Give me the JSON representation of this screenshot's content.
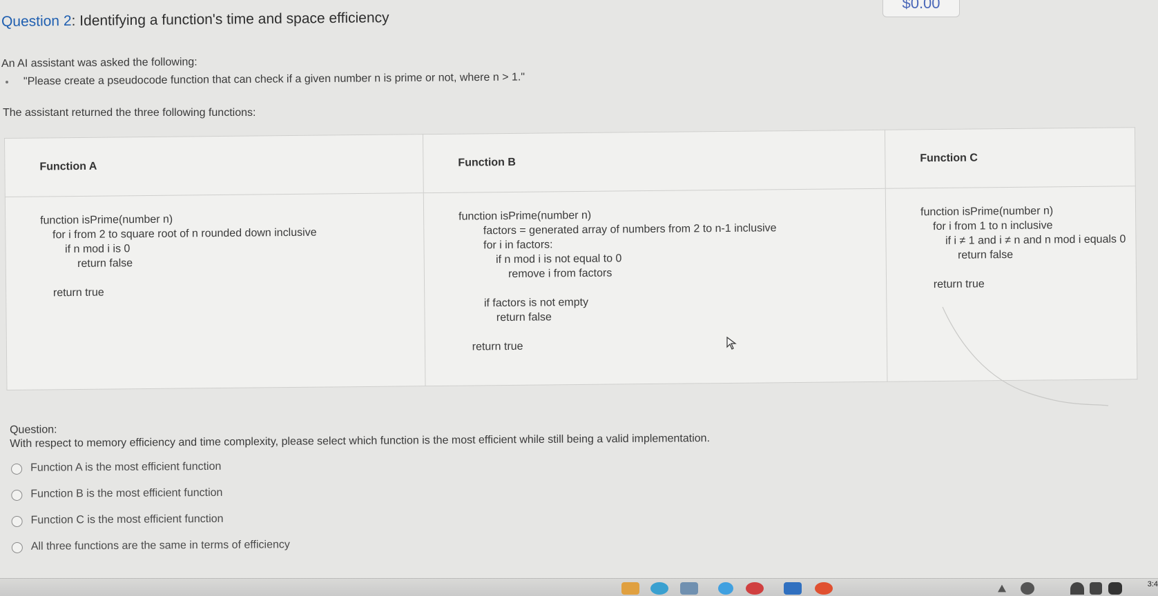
{
  "header": {
    "price": "$0.00",
    "question_number": "Question 2",
    "title_rest": ": Identifying a function's time and space efficiency"
  },
  "prompt": {
    "intro": "An AI assistant was asked the following:",
    "bullet": "\"Please create a pseudocode function that can check if a given number n is prime or not, where n > 1.\"",
    "returned": "The assistant returned the three following functions:"
  },
  "functions": [
    {
      "name": "Function A",
      "code": [
        "function isPrime(number n)",
        "    for i from 2 to square root of n rounded down inclusive",
        "        if n mod i is 0",
        "            return false",
        "",
        "    return true"
      ]
    },
    {
      "name": "Function B",
      "code": [
        "function isPrime(number n)",
        "        factors = generated array of numbers from 2 to n-1 inclusive",
        "        for i in factors:",
        "            if n mod i is not equal to 0",
        "                remove i from factors",
        "",
        "        if factors is not empty",
        "            return false",
        "",
        "    return true"
      ]
    },
    {
      "name": "Function C",
      "code": [
        "function isPrime(number n)",
        "    for i from 1 to n inclusive",
        "        if i ≠ 1 and i ≠ n and n mod i equals 0",
        "            return false",
        "",
        "    return true"
      ]
    }
  ],
  "question": {
    "label": "Question:",
    "text": "With respect to memory efficiency and time complexity, please select which function is the most efficient while still being a valid implementation.",
    "options": [
      "Function A is the most efficient function",
      "Function B is the most efficient function",
      "Function C is the most efficient function",
      "All three functions are the same in terms of efficiency"
    ]
  },
  "taskbar": {
    "time": "3:4"
  },
  "icons": [
    "cursor-icon",
    "radio-icon",
    "taskbar-app-icon",
    "wifi-icon",
    "volume-icon",
    "battery-icon"
  ]
}
